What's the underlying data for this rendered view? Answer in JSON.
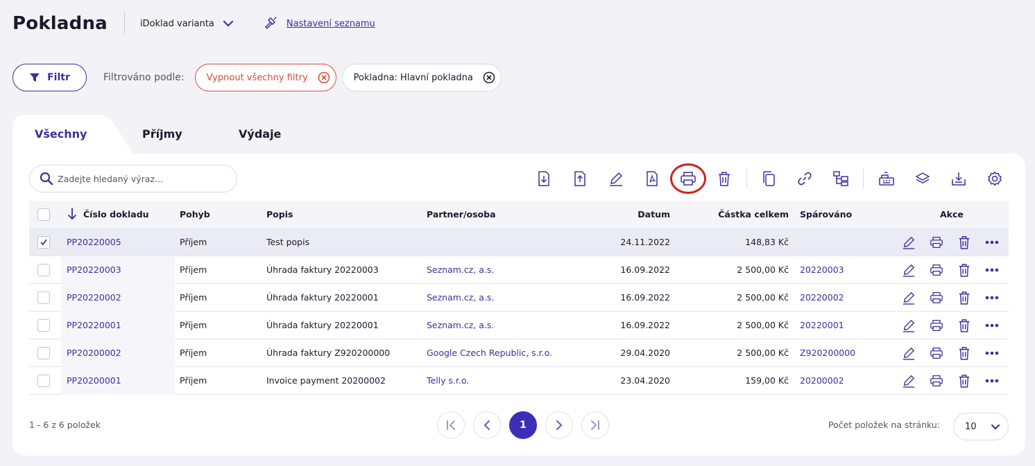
{
  "header": {
    "title": "Pokladna",
    "variant": "iDoklad varianta",
    "settings_link": "Nastavení seznamu"
  },
  "filters": {
    "button_label": "Filtr",
    "filtered_by_label": "Filtrováno podle:",
    "chips": [
      "Vypnout všechny filtry",
      "Pokladna: Hlavní pokladna"
    ]
  },
  "tabs": [
    "Všechny",
    "Příjmy",
    "Výdaje"
  ],
  "search": {
    "placeholder": "Zadejte hledaný výraz..."
  },
  "table": {
    "columns": [
      "Číslo dokladu",
      "Pohyb",
      "Popis",
      "Partner/osoba",
      "Datum",
      "Částka celkem",
      "Spárováno",
      "Akce"
    ],
    "rows": [
      {
        "number": "PP20220005",
        "movement": "Příjem",
        "description": "Test popis",
        "partner": "",
        "date": "24.11.2022",
        "amount": "148,83 Kč",
        "paired": "",
        "selected": true
      },
      {
        "number": "PP20220003",
        "movement": "Příjem",
        "description": "Úhrada faktury 20220003",
        "partner": "Seznam.cz, a.s.",
        "date": "16.09.2022",
        "amount": "2 500,00 Kč",
        "paired": "20220003",
        "selected": false
      },
      {
        "number": "PP20220002",
        "movement": "Příjem",
        "description": "Úhrada faktury 20220001",
        "partner": "Seznam.cz, a.s.",
        "date": "16.09.2022",
        "amount": "2 500,00 Kč",
        "paired": "20220002",
        "selected": false
      },
      {
        "number": "PP20220001",
        "movement": "Příjem",
        "description": "Úhrada faktury 20220001",
        "partner": "Seznam.cz, a.s.",
        "date": "16.09.2022",
        "amount": "2 500,00 Kč",
        "paired": "20220001",
        "selected": false
      },
      {
        "number": "PP20200002",
        "movement": "Příjem",
        "description": "Úhrada faktury Z920200000",
        "partner": "Google Czech Republic, s.r.o.",
        "date": "29.04.2020",
        "amount": "2 500,00 Kč",
        "paired": "Z920200000",
        "selected": false
      },
      {
        "number": "PP20200001",
        "movement": "Příjem",
        "description": "Invoice payment 20200002",
        "partner": "Telly s.r.o.",
        "date": "23.04.2020",
        "amount": "159,00 Kč",
        "paired": "20200002",
        "selected": false
      }
    ]
  },
  "footer": {
    "count": "1 - 6 z 6 položek",
    "current_page": "1",
    "per_page_label": "Počet položek na stránku:",
    "per_page_value": "10"
  },
  "colors": {
    "accent": "#3b2f9e",
    "danger": "#d94a3a",
    "highlight": "#d32020"
  }
}
